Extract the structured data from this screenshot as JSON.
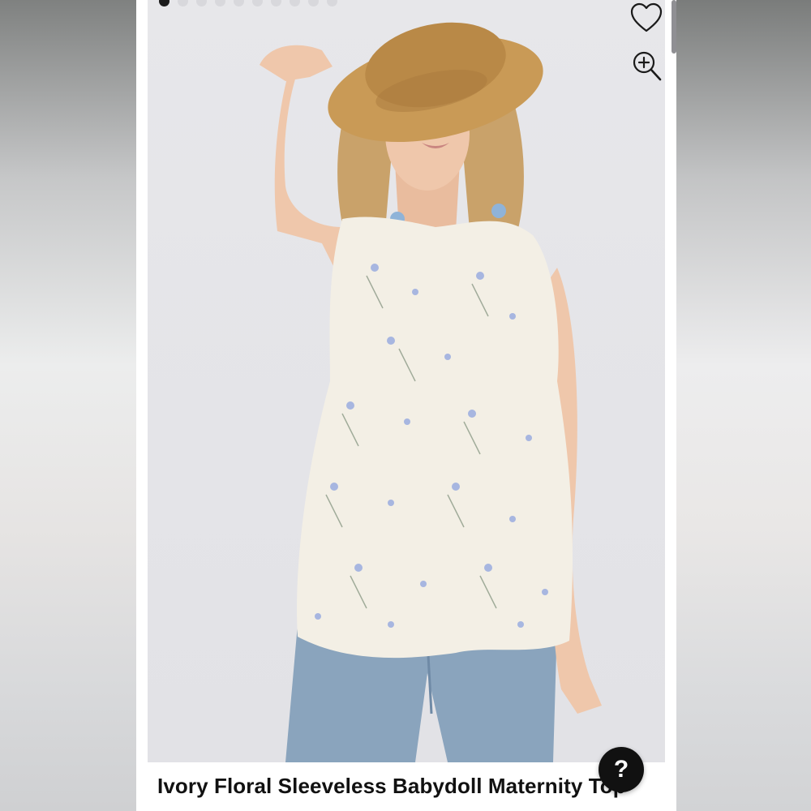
{
  "carousel": {
    "total": 10,
    "active": 0
  },
  "listing": {
    "title": "Ivory Floral Sleeveless Babydoll Maternity Top"
  },
  "help": {
    "label": "?"
  },
  "icons": {
    "favorite": "heart-icon",
    "zoom": "zoom-in-icon"
  }
}
